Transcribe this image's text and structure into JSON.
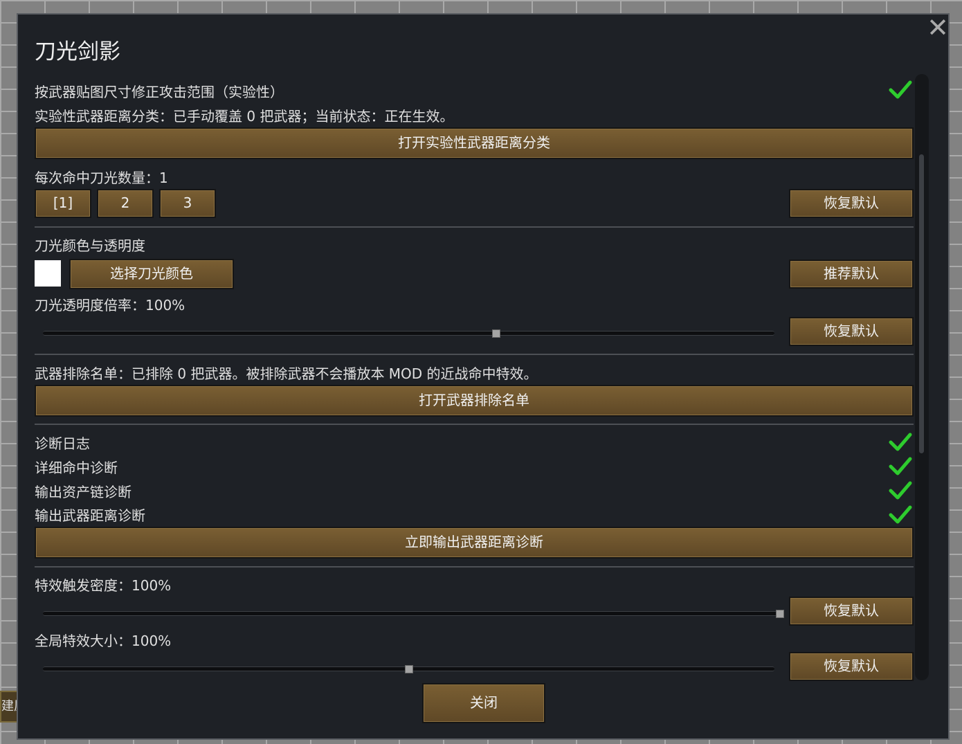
{
  "background": {
    "tab_text": "建屋"
  },
  "dialog": {
    "title": "刀光剑影",
    "close_label": "关闭",
    "sections": {
      "range": {
        "toggle_label": "按武器贴图尺寸修正攻击范围（实验性）",
        "toggle_checked": true,
        "status": "实验性武器距离分类：已手动覆盖 0 把武器；当前状态：正在生效。",
        "open_button": "打开实验性武器距离分类"
      },
      "count": {
        "label": "每次命中刀光数量：1",
        "options": [
          "[1]",
          "2",
          "3"
        ],
        "reset_button": "恢复默认"
      },
      "color": {
        "heading": "刀光颜色与透明度",
        "swatch_color": "#ffffff",
        "pick_button": "选择刀光颜色",
        "recommend_button": "推荐默认",
        "opacity_label": "刀光透明度倍率：100%",
        "opacity_slider_fraction": 0.62,
        "reset_button": "恢复默认"
      },
      "exclude": {
        "label": "武器排除名单：已排除 0 把武器。被排除武器不会播放本 MOD 的近战命中特效。",
        "open_button": "打开武器排除名单"
      },
      "diagnostics": {
        "items": [
          {
            "label": "诊断日志",
            "checked": true
          },
          {
            "label": "详细命中诊断",
            "checked": true
          },
          {
            "label": "输出资产链诊断",
            "checked": true
          },
          {
            "label": "输出武器距离诊断",
            "checked": true
          }
        ],
        "export_button": "立即输出武器距离诊断"
      },
      "density": {
        "label": "特效触发密度：100%",
        "slider_fraction": 1.0,
        "reset_button": "恢复默认"
      },
      "size": {
        "label": "全局特效大小：100%",
        "slider_fraction": 0.5,
        "reset_button": "恢复默认"
      }
    }
  },
  "colors": {
    "check_green": "#2ecc2e",
    "button_brown": "#6b522c",
    "panel_bg": "#1e2126"
  }
}
